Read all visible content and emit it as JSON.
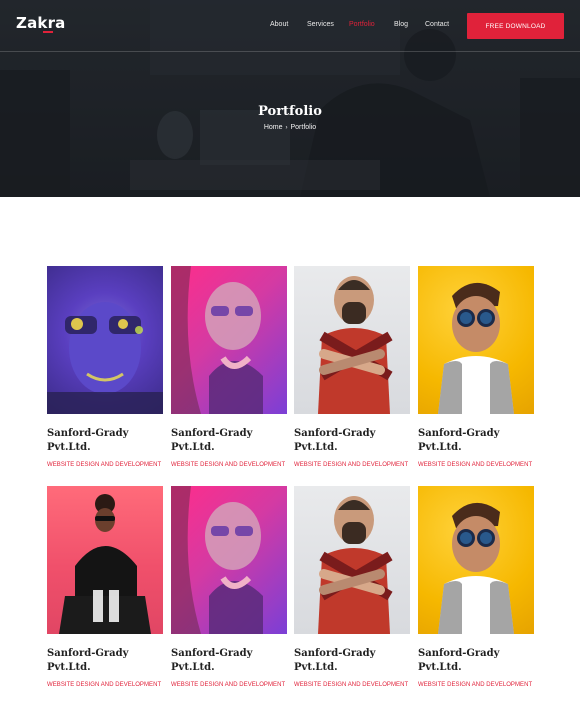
{
  "header": {
    "logo": "Zakra",
    "nav": [
      {
        "label": "About",
        "active": false
      },
      {
        "label": "Services",
        "active": false
      },
      {
        "label": "Portfolio",
        "active": true
      },
      {
        "label": "Blog",
        "active": false
      },
      {
        "label": "Contact",
        "active": false
      }
    ],
    "cta_label": "FREE DOWNLOAD"
  },
  "hero": {
    "title": "Portfolio",
    "breadcrumb": [
      "Home",
      "Portfolio"
    ]
  },
  "portfolio": {
    "items": [
      {
        "title_line1": "Sanford-Grady",
        "title_line2": "Pvt.Ltd.",
        "category": "WEBSITE DESIGN AND DEVELOPMENT",
        "image": "man-face-paint"
      },
      {
        "title_line1": "Sanford-Grady",
        "title_line2": "Pvt.Ltd.",
        "category": "WEBSITE DESIGN AND DEVELOPMENT",
        "image": "woman-neon-glasses"
      },
      {
        "title_line1": "Sanford-Grady",
        "title_line2": "Pvt.Ltd.",
        "category": "WEBSITE DESIGN AND DEVELOPMENT",
        "image": "man-crossed-arms"
      },
      {
        "title_line1": "Sanford-Grady",
        "title_line2": "Pvt.Ltd.",
        "category": "WEBSITE DESIGN AND DEVELOPMENT",
        "image": "man-sunglasses-yellow"
      },
      {
        "title_line1": "Sanford-Grady",
        "title_line2": "Pvt.Ltd.",
        "category": "WEBSITE DESIGN AND DEVELOPMENT",
        "image": "woman-sitting-chair"
      },
      {
        "title_line1": "Sanford-Grady",
        "title_line2": "Pvt.Ltd.",
        "category": "WEBSITE DESIGN AND DEVELOPMENT",
        "image": "woman-neon-glasses"
      },
      {
        "title_line1": "Sanford-Grady",
        "title_line2": "Pvt.Ltd.",
        "category": "WEBSITE DESIGN AND DEVELOPMENT",
        "image": "man-crossed-arms"
      },
      {
        "title_line1": "Sanford-Grady",
        "title_line2": "Pvt.Ltd.",
        "category": "WEBSITE DESIGN AND DEVELOPMENT",
        "image": "man-sunglasses-yellow"
      }
    ]
  },
  "colors": {
    "accent": "#e0223a",
    "hero_bg": "#262a2f"
  }
}
